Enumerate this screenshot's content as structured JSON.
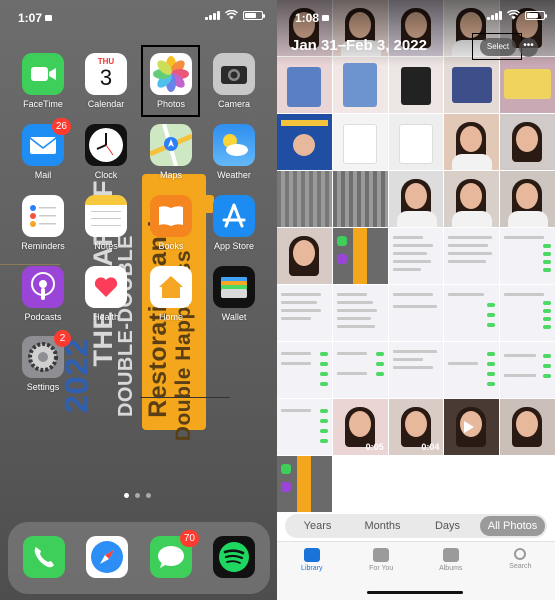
{
  "home": {
    "status": {
      "time": "1:07"
    },
    "apps": [
      {
        "id": "facetime",
        "label": "FaceTime"
      },
      {
        "id": "calendar",
        "label": "Calendar",
        "day_name": "THU",
        "day_num": "3"
      },
      {
        "id": "photos",
        "label": "Photos"
      },
      {
        "id": "camera",
        "label": "Camera"
      },
      {
        "id": "mail",
        "label": "Mail",
        "badge": "26"
      },
      {
        "id": "clock",
        "label": "Clock"
      },
      {
        "id": "maps",
        "label": "Maps"
      },
      {
        "id": "weather",
        "label": "Weather"
      },
      {
        "id": "reminders",
        "label": "Reminders"
      },
      {
        "id": "notes",
        "label": "Notes"
      },
      {
        "id": "books",
        "label": "Books"
      },
      {
        "id": "appstore",
        "label": "App Store"
      },
      {
        "id": "podcasts",
        "label": "Podcasts"
      },
      {
        "id": "health",
        "label": "Health"
      },
      {
        "id": "home",
        "label": "Home"
      },
      {
        "id": "wallet",
        "label": "Wallet"
      },
      {
        "id": "settings",
        "label": "Settings",
        "badge": "2"
      }
    ],
    "dock": [
      {
        "id": "phone"
      },
      {
        "id": "safari"
      },
      {
        "id": "messages",
        "badge": "70"
      },
      {
        "id": "spotify"
      }
    ],
    "wallpaper_text": {
      "year": "2022",
      "line1": "THE YEAR OF",
      "line2": "DOUBLE-DOUBLE",
      "line3": "Restoration and",
      "line4": "Double Happiness"
    },
    "page_dots": 3,
    "active_page": 0
  },
  "photos": {
    "status": {
      "time": "1:08"
    },
    "date_range": "Jan 31–Feb 3, 2022",
    "select_label": "Select",
    "more_label": "•••",
    "video_durations": [
      "0:05",
      "0:04"
    ],
    "segments": [
      "Years",
      "Months",
      "Days",
      "All Photos"
    ],
    "selected_segment": "All Photos",
    "tabs": [
      "Library",
      "For You",
      "Albums",
      "Search"
    ],
    "active_tab": "Library"
  },
  "colors": {
    "badge": "#ff3b30",
    "accent": "#1a73d9",
    "poster": "#f4a71c",
    "toggle": "#4cd964"
  }
}
